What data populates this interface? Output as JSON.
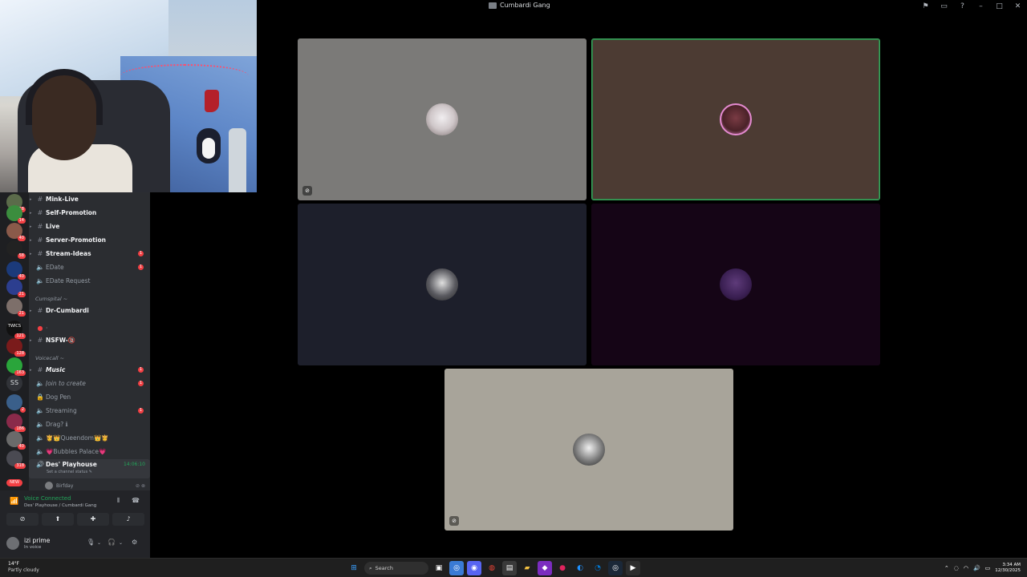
{
  "window": {
    "title": "Cumbardi Gang",
    "controls": [
      "flag-icon",
      "screen-icon",
      "help-icon",
      "minimize",
      "maximize",
      "close"
    ]
  },
  "servers": [
    {
      "badge": "18"
    },
    {
      "badge": "14"
    },
    {
      "badge": "40"
    },
    {
      "badge": "58"
    },
    {
      "badge": "40"
    },
    {
      "badge": "21"
    },
    {
      "badge": "21"
    },
    {
      "badge": "121",
      "label": "TWICS"
    },
    {
      "badge": "128"
    },
    {
      "badge": "163"
    },
    {
      "label": "SS"
    },
    {
      "badge": "2"
    },
    {
      "badge": "186"
    },
    {
      "badge": "40"
    },
    {
      "badge": "318"
    },
    {
      "label": "NEW"
    }
  ],
  "channels": [
    {
      "type": "text",
      "name": "Mink-Live",
      "bold": true
    },
    {
      "type": "text",
      "name": "Self-Promotion",
      "bold": true
    },
    {
      "type": "text",
      "name": "Live",
      "bold": true
    },
    {
      "type": "text",
      "name": "Server-Promotion",
      "bold": true
    },
    {
      "type": "text",
      "name": "Stream-Ideas",
      "bold": true,
      "unread": "1"
    },
    {
      "type": "voice",
      "name": "EDate",
      "unread": "1"
    },
    {
      "type": "voice",
      "name": "EDate Request"
    }
  ],
  "category_cumspital": "Cumspital ~",
  "channels2": [
    {
      "type": "text",
      "name": "Dr-Cumbardi",
      "bold": true
    },
    {
      "type": "voice",
      "name": "·"
    },
    {
      "type": "text",
      "name": "NSFW-🔞",
      "bold": true
    }
  ],
  "category_voicecall": "Voicecall ~",
  "channels3": [
    {
      "type": "text",
      "name": "Music",
      "bold": true,
      "unread": "1"
    },
    {
      "type": "voice",
      "name": "Join to create",
      "unread": "1"
    },
    {
      "type": "lock",
      "name": "Dog Pen"
    },
    {
      "type": "voice",
      "name": "Streaming",
      "unread": "1"
    },
    {
      "type": "voice",
      "name": "Drag? ℹ"
    },
    {
      "type": "voice",
      "name": "👸👑Queendom👑👸"
    },
    {
      "type": "voice",
      "name": "💗Bubbles Palace💗"
    }
  ],
  "active_channel": {
    "name": "Des' Playhouse",
    "time": "14:06:10",
    "status": "Set a channel status ✎"
  },
  "member": {
    "name": "Birfday"
  },
  "voice": {
    "status": "Voice Connected",
    "location": "Des' Playhouse / Cumbardi Gang"
  },
  "user": {
    "name": "izi prime",
    "status": "In voice"
  },
  "taskbar": {
    "temp": "14°F",
    "condition": "Partly cloudy",
    "search_placeholder": "Search",
    "time": "3:34 AM",
    "date": "12/30/2025"
  },
  "colors": {
    "speaking_border": "#3ba55d",
    "unread_badge": "#f23f43",
    "voice_green": "#23a55a"
  }
}
